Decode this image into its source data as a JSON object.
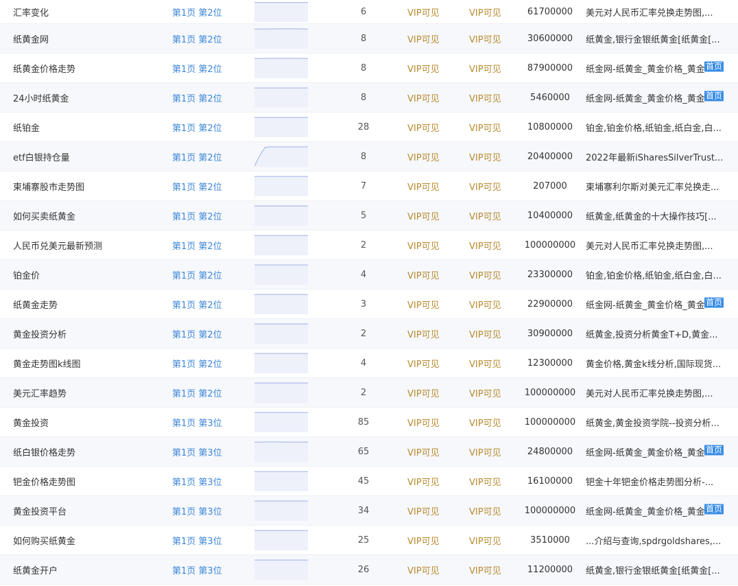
{
  "rows": [
    {
      "keyword": "汇率变化",
      "rank": "第1页 第2位",
      "count": "6",
      "vip1": "VIP可见",
      "vip2": "VIP可见",
      "results": "61700000",
      "title": "美元对人民币汇率兑换走势图,...",
      "badge": "",
      "trend": [
        0.98,
        0.98,
        0.98,
        0.98,
        0.98,
        0.98,
        0.98,
        0.98,
        0.98,
        0.98,
        0.98
      ]
    },
    {
      "keyword": "纸黄金网",
      "rank": "第1页 第2位",
      "count": "8",
      "vip1": "VIP可见",
      "vip2": "VIP可见",
      "results": "30600000",
      "title": "纸黄金,银行金银纸黄金[纸黄金[...",
      "badge": "",
      "trend": [
        0.99,
        0.99,
        0.99,
        0.995,
        1,
        1,
        1,
        1,
        1,
        0.995,
        0.99
      ]
    },
    {
      "keyword": "纸黄金价格走势",
      "rank": "第1页 第2位",
      "count": "8",
      "vip1": "VIP可见",
      "vip2": "VIP可见",
      "results": "87900000",
      "title": "纸金网-纸黄金_黄金价格_黄金",
      "badge": "首页",
      "trend": [
        0.99,
        0.995,
        0.995,
        1,
        1,
        1,
        1,
        1,
        1,
        0.995,
        0.995
      ]
    },
    {
      "keyword": "24小时纸黄金",
      "rank": "第1页 第2位",
      "count": "8",
      "vip1": "VIP可见",
      "vip2": "VIP可见",
      "results": "5460000",
      "title": "纸金网-纸黄金_黄金价格_黄金",
      "badge": "首页",
      "trend": [
        0.995,
        0.995,
        0.995,
        0.995,
        0.995,
        0.995,
        0.995,
        0.995,
        0.995,
        0.995,
        0.995
      ]
    },
    {
      "keyword": "纸铂金",
      "rank": "第1页 第2位",
      "count": "28",
      "vip1": "VIP可见",
      "vip2": "VIP可见",
      "results": "10800000",
      "title": "铂金,铂金价格,纸铂金,纸白金,白...",
      "badge": "",
      "trend": [
        0.995,
        0.995,
        0.995,
        0.995,
        0.995,
        0.995,
        0.995,
        0.995,
        0.995,
        0.995,
        0.995
      ]
    },
    {
      "keyword": "etf白银持仓量",
      "rank": "第1页 第2位",
      "count": "8",
      "vip1": "VIP可见",
      "vip2": "VIP可见",
      "results": "20400000",
      "title": "2022年最新iSharesSilverTrust...",
      "badge": "",
      "trend": [
        0,
        0.55,
        0.98,
        1,
        1,
        1,
        1,
        1,
        1,
        1,
        1
      ]
    },
    {
      "keyword": "柬埔寨股市走势图",
      "rank": "第1页 第2位",
      "count": "7",
      "vip1": "VIP可见",
      "vip2": "VIP可见",
      "results": "207000",
      "title": "柬埔寨利尔斯对美元汇率兑换走...",
      "badge": "",
      "trend": [
        0.995,
        0.995,
        0.995,
        0.995,
        0.995,
        0.995,
        0.995,
        0.995,
        0.995,
        0.995,
        0.995
      ]
    },
    {
      "keyword": "如何买卖纸黄金",
      "rank": "第1页 第2位",
      "count": "5",
      "vip1": "VIP可见",
      "vip2": "VIP可见",
      "results": "10400000",
      "title": "纸黄金,纸黄金的十大操作技巧[...",
      "badge": "",
      "trend": [
        0.995,
        0.995,
        0.995,
        0.995,
        0.995,
        0.995,
        0.995,
        0.995,
        0.995,
        0.995,
        0.995
      ]
    },
    {
      "keyword": "人民币兑美元最新预测",
      "rank": "第1页 第2位",
      "count": "2",
      "vip1": "VIP可见",
      "vip2": "VIP可见",
      "results": "100000000",
      "title": "美元对人民币汇率兑换走势图,...",
      "badge": "",
      "trend": [
        0.99,
        0.99,
        0.99,
        0.99,
        0.99,
        0.99,
        0.99,
        0.99,
        0.99,
        0.99,
        0.99
      ]
    },
    {
      "keyword": "铂金价",
      "rank": "第1页 第2位",
      "count": "4",
      "vip1": "VIP可见",
      "vip2": "VIP可见",
      "results": "23300000",
      "title": "铂金,铂金价格,纸铂金,纸白金,白...",
      "badge": "",
      "trend": [
        0.995,
        0.995,
        0.995,
        0.995,
        0.995,
        0.995,
        0.995,
        0.995,
        0.995,
        0.995,
        0.995
      ]
    },
    {
      "keyword": "纸黄金走势",
      "rank": "第1页 第2位",
      "count": "3",
      "vip1": "VIP可见",
      "vip2": "VIP可见",
      "results": "22900000",
      "title": "纸金网-纸黄金_黄金价格_黄金",
      "badge": "首页",
      "trend": [
        0.995,
        0.995,
        0.995,
        0.995,
        0.995,
        0.995,
        0.995,
        0.995,
        0.995,
        0.995,
        0.995
      ]
    },
    {
      "keyword": "黄金投资分析",
      "rank": "第1页 第2位",
      "count": "2",
      "vip1": "VIP可见",
      "vip2": "VIP可见",
      "results": "30900000",
      "title": "纸黄金,投资分析黄金T+D,黄金...",
      "badge": "",
      "trend": [
        0.995,
        0.995,
        0.995,
        0.995,
        0.995,
        0.995,
        0.995,
        0.995,
        0.995,
        0.995,
        0.995
      ]
    },
    {
      "keyword": "黄金走势图k线图",
      "rank": "第1页 第2位",
      "count": "4",
      "vip1": "VIP可见",
      "vip2": "VIP可见",
      "results": "12300000",
      "title": "黄金价格,黄金k线分析,国际现货...",
      "badge": "",
      "trend": [
        0.995,
        0.995,
        0.995,
        0.995,
        0.995,
        0.995,
        0.995,
        0.995,
        0.995,
        0.995,
        0.995
      ]
    },
    {
      "keyword": "美元汇率趋势",
      "rank": "第1页 第2位",
      "count": "2",
      "vip1": "VIP可见",
      "vip2": "VIP可见",
      "results": "100000000",
      "title": "美元对人民币汇率兑换走势图,...",
      "badge": "",
      "trend": [
        0.995,
        0.995,
        0.995,
        0.995,
        0.995,
        0.995,
        0.995,
        0.995,
        0.995,
        0.995,
        0.995
      ]
    },
    {
      "keyword": "黄金投资",
      "rank": "第1页 第3位",
      "count": "85",
      "vip1": "VIP可见",
      "vip2": "VIP可见",
      "results": "100000000",
      "title": "纸黄金,黄金投资学院--投资分析...",
      "badge": "",
      "trend": [
        0.995,
        0.995,
        0.995,
        0.995,
        0.995,
        0.995,
        0.995,
        0.995,
        0.995,
        0.995,
        0.995
      ]
    },
    {
      "keyword": "纸白银价格走势",
      "rank": "第1页 第3位",
      "count": "65",
      "vip1": "VIP可见",
      "vip2": "VIP可见",
      "results": "24800000",
      "title": "纸金网-纸黄金_黄金价格_黄金",
      "badge": "首页",
      "trend": [
        0.99,
        0.99,
        0.995,
        1,
        1,
        0.995,
        0.99,
        0.99,
        0.99,
        0.99,
        0.99
      ]
    },
    {
      "keyword": "钯金价格走势图",
      "rank": "第1页 第3位",
      "count": "45",
      "vip1": "VIP可见",
      "vip2": "VIP可见",
      "results": "16100000",
      "title": "钯金十年钯金价格走势图分析-...",
      "badge": "",
      "trend": [
        0.995,
        0.995,
        0.995,
        0.995,
        0.995,
        0.995,
        0.995,
        0.995,
        0.995,
        0.995,
        0.995
      ]
    },
    {
      "keyword": "黄金投资平台",
      "rank": "第1页 第3位",
      "count": "34",
      "vip1": "VIP可见",
      "vip2": "VIP可见",
      "results": "100000000",
      "title": "纸金网-纸黄金_黄金价格_黄金",
      "badge": "首页",
      "trend": [
        0.995,
        0.995,
        0.995,
        0.995,
        0.995,
        0.995,
        0.995,
        0.995,
        0.995,
        0.995,
        0.995
      ]
    },
    {
      "keyword": "如何购买纸黄金",
      "rank": "第1页 第3位",
      "count": "25",
      "vip1": "VIP可见",
      "vip2": "VIP可见",
      "results": "3510000",
      "title": "...介绍与查询,spdrgoldshares,...",
      "badge": "",
      "trend": [
        0.995,
        0.995,
        0.995,
        0.995,
        0.995,
        0.995,
        0.995,
        0.995,
        0.995,
        0.995,
        0.995
      ]
    },
    {
      "keyword": "纸黄金开户",
      "rank": "第1页 第3位",
      "count": "26",
      "vip1": "VIP可见",
      "vip2": "VIP可见",
      "results": "11200000",
      "title": "纸黄金,银行金银纸黄金[纸黄金[...",
      "badge": "",
      "trend": [
        0.995,
        0.995,
        0.995,
        0.995,
        0.995,
        0.995,
        0.995,
        0.995,
        0.995,
        0.995,
        0.995
      ]
    }
  ]
}
